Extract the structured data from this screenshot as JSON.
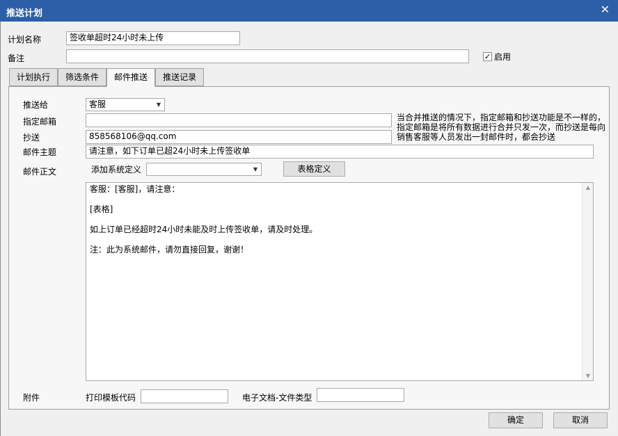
{
  "window": {
    "title": "推送计划",
    "close_glyph": "✕"
  },
  "form": {
    "plan_name_label": "计划名称",
    "plan_name_value": "签收单超时24小时未上传",
    "remark_label": "备注",
    "remark_value": "",
    "enabled_label": "启用",
    "enabled_checked": true,
    "enabled_check_glyph": "✓"
  },
  "tabs": [
    {
      "label": "计划执行",
      "active": false
    },
    {
      "label": "筛选条件",
      "active": false
    },
    {
      "label": "邮件推送",
      "active": true
    },
    {
      "label": "推送记录",
      "active": false
    }
  ],
  "mail": {
    "send_to_label": "推送给",
    "send_to_value": "客服",
    "dropdown_glyph": "▼",
    "specified_email_label": "指定邮箱",
    "specified_email_value": "",
    "cc_label": "抄送",
    "cc_value": "858568106@qq.com",
    "subject_label": "邮件主题",
    "subject_value": "请注意，如下订单已超24小时未上传签收单",
    "body_label": "邮件正文",
    "add_sys_def_label": "添加系统定义",
    "add_sys_def_value": "",
    "table_def_button": "表格定义",
    "note": "当合并推送的情况下，指定邮箱和抄送功能是不一样的，指定邮箱是将所有数据进行合并只发一次，而抄送是每向销售客服等人员发出一封邮件时，都会抄送",
    "body_lines": [
      "客服：[客服]，请注意：",
      "[表格]",
      "如上订单已经超时24小时未能及时上传签收单，请及时处理。",
      "注：此为系统邮件，请勿直接回复，谢谢！"
    ],
    "scroll_up_glyph": "▲",
    "scroll_down_glyph": "▼"
  },
  "attachment": {
    "label": "附件",
    "print_template_label": "打印模板代码",
    "print_template_value": "",
    "edoc_type_label": "电子文档-文件类型",
    "edoc_type_value": ""
  },
  "footer": {
    "ok_label": "确定",
    "cancel_label": "取消"
  }
}
